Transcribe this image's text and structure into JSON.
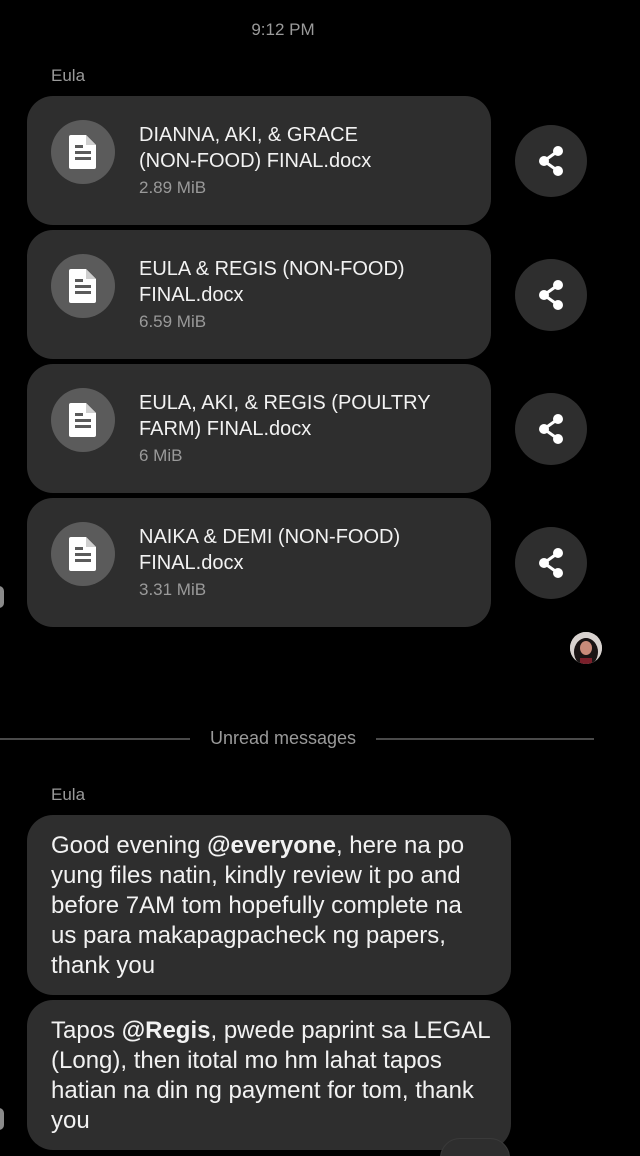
{
  "conversation": {
    "timestamp": "9:12 PM",
    "first_group": {
      "sender": "Eula",
      "files": [
        {
          "name_line1": "DIANNA, AKI, & GRACE",
          "name_line2": "(NON-FOOD) FINAL.docx",
          "size": "2.89 MiB",
          "icon": "document-icon",
          "action_icon": "share-icon"
        },
        {
          "name_line1": "EULA & REGIS (NON-FOOD)",
          "name_line2": "FINAL.docx",
          "size": "6.59 MiB",
          "icon": "document-icon",
          "action_icon": "share-icon"
        },
        {
          "name_line1": "EULA, AKI, & REGIS (POULTRY",
          "name_line2": "FARM) FINAL.docx",
          "size": "6 MiB",
          "icon": "document-icon",
          "action_icon": "share-icon"
        },
        {
          "name_line1": "NAIKA & DEMI (NON-FOOD)",
          "name_line2": "FINAL.docx",
          "size": "3.31 MiB",
          "icon": "document-icon",
          "action_icon": "share-icon"
        }
      ]
    },
    "unread_divider": "Unread messages",
    "second_group": {
      "sender": "Eula",
      "messages": [
        {
          "before": "Good evening ",
          "mention": "@everyone",
          "after": ", here na po yung files natin, kindly review it po and before 7AM tom hopefully complete na us para makapagpacheck ng papers, thank you"
        },
        {
          "before": "Tapos ",
          "mention": "@Regis",
          "after": ", pwede paprint sa LEGAL (Long), then itotal mo hm lahat tapos hatian na din ng payment for tom, thank you"
        }
      ]
    }
  },
  "colors": {
    "background": "#000000",
    "bubble": "#2e2e2e",
    "icon_circle": "#5b5b5b",
    "muted_text": "#9a9a9a",
    "primary_text": "#f2f2f2"
  }
}
